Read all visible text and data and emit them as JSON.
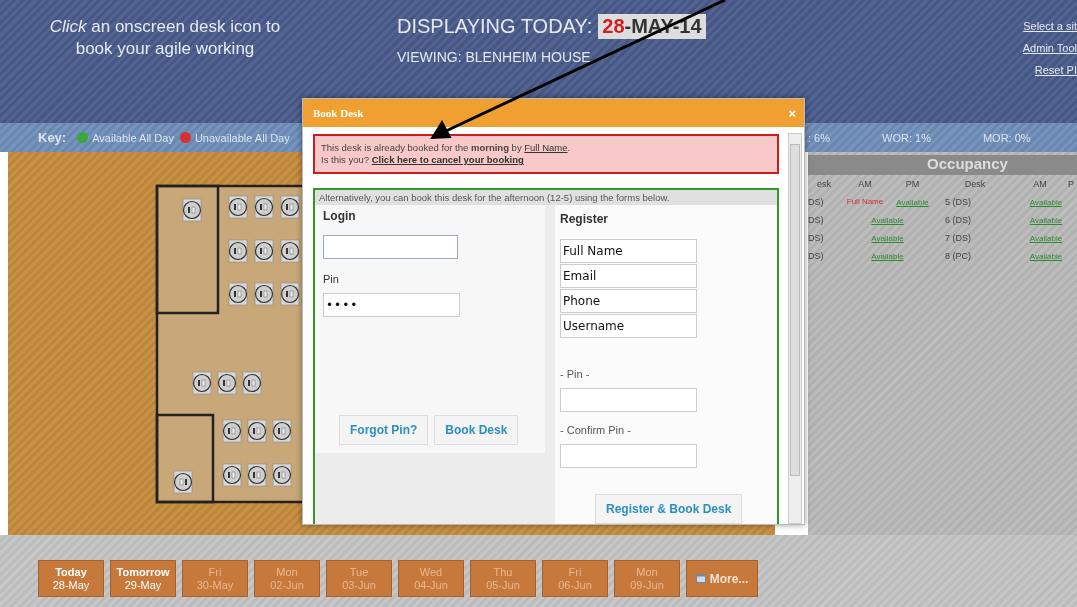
{
  "header": {
    "instruction": "*Click* an onscreen desk icon to book your agile working",
    "displaying_label": "DISPLAYING TODAY:",
    "date_day": "28",
    "date_rest": "-MAY-14",
    "viewing": "VIEWING: BLENHEIM HOUSE",
    "links": [
      "Select a sit",
      "Admin Tool",
      "Reset PI"
    ]
  },
  "key_bar": {
    "label": "Key:",
    "items": [
      {
        "label": "Available All Day",
        "color": "#3aa83a"
      },
      {
        "label": "Unavailable All Day",
        "color": "#d83030"
      }
    ],
    "stats": [
      ": 6%",
      "WOR: 1%",
      "MOR: 0%"
    ]
  },
  "occupancy": {
    "title": "Occupancy",
    "columns": [
      "esk",
      "AM",
      "PM",
      "Desk",
      "AM",
      "P"
    ],
    "rows": [
      {
        "desk": "DS)",
        "am": "Full Name",
        "pm": "Available",
        "desk2": "5 (DS)",
        "status2": "Available"
      },
      {
        "desk": "DS)",
        "am": null,
        "pm": "Available",
        "desk2": "6 (DS)",
        "status2": "Available"
      },
      {
        "desk": "DS)",
        "am": null,
        "pm": "Available",
        "desk2": "7 (DS)",
        "status2": "Available"
      },
      {
        "desk": "DS)",
        "am": null,
        "pm": "Available",
        "desk2": "8 (PC)",
        "status2": "Available"
      }
    ]
  },
  "days": [
    {
      "day": "Today",
      "date": "28-May",
      "disabled": false
    },
    {
      "day": "Tomorrow",
      "date": "29-May",
      "disabled": false
    },
    {
      "day": "Fri",
      "date": "30-May",
      "disabled": true
    },
    {
      "day": "Mon",
      "date": "02-Jun",
      "disabled": true
    },
    {
      "day": "Tue",
      "date": "03-Jun",
      "disabled": true
    },
    {
      "day": "Wed",
      "date": "04-Jun",
      "disabled": true
    },
    {
      "day": "Thu",
      "date": "05-Jun",
      "disabled": true
    },
    {
      "day": "Fri",
      "date": "06-Jun",
      "disabled": true
    },
    {
      "day": "Mon",
      "date": "09-Jun",
      "disabled": true
    }
  ],
  "more_button": "More...",
  "dialog": {
    "title": "Book Desk",
    "close": "×",
    "alert_line": "This desk is already booked for the **morning** by ",
    "alert_name": "Full Name",
    "alert_end": ".",
    "alert_question": "Is this you?",
    "cancel_link": "Click here to cancel your booking",
    "note": "Alternatively, you can book this desk for the afternoon (12-5) using the forms below.",
    "login": {
      "title": "Login",
      "pin_label": "Pin",
      "pin_value": "••••",
      "buttons": [
        "Forgot Pin?",
        "Book Desk"
      ]
    },
    "register": {
      "title": "Register",
      "fields": [
        {
          "placeholder": "Full Name"
        },
        {
          "placeholder": "Email"
        },
        {
          "placeholder": "Phone"
        },
        {
          "placeholder": "Username"
        }
      ],
      "pin_label": "- Pin -",
      "confirm_label": "- Confirm Pin -",
      "button": "Register & Book Desk"
    }
  }
}
